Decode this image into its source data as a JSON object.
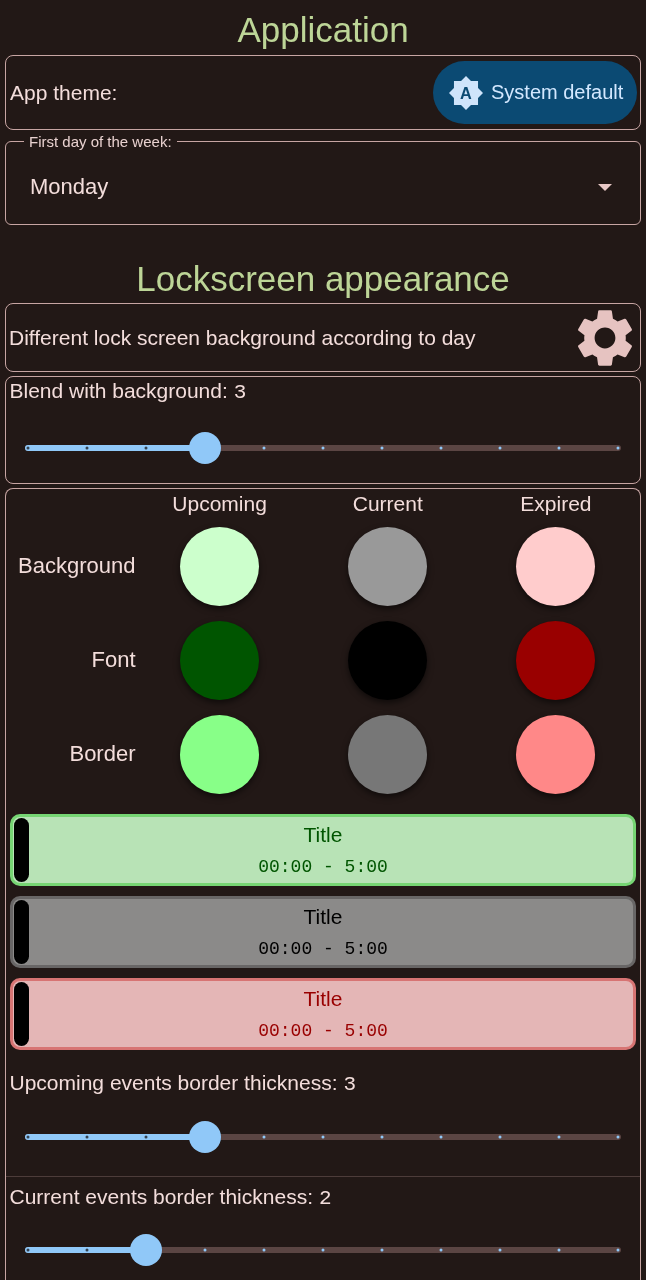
{
  "application": {
    "heading": "Application",
    "app_theme": {
      "label": "App theme:",
      "button": {
        "icon_letter": "A",
        "label": "System default"
      }
    },
    "first_day": {
      "label": "First day of the week:",
      "value": "Monday"
    }
  },
  "lockscreen": {
    "heading": "Lockscreen appearance",
    "day_background": {
      "label": "Different lock screen background according to day"
    },
    "blend": {
      "label": "Blend with background:",
      "value": "3",
      "level": 0.3
    },
    "colors": {
      "columns": [
        "Upcoming",
        "Current",
        "Expired"
      ],
      "rows": [
        {
          "label": "Background",
          "swatches": [
            {
              "color": "#ccffcc"
            },
            {
              "color": "#999999"
            },
            {
              "color": "#ffcccc"
            }
          ]
        },
        {
          "label": "Font",
          "swatches": [
            {
              "color": "#005500"
            },
            {
              "color": "#000000"
            },
            {
              "color": "#990000"
            }
          ]
        },
        {
          "label": "Border",
          "swatches": [
            {
              "color": "#88ff88"
            },
            {
              "color": "#777777"
            },
            {
              "color": "#ff8888"
            }
          ]
        }
      ]
    },
    "previews": [
      {
        "title": "Title",
        "time": "00:00 - 5:00"
      },
      {
        "title": "Title",
        "time": "00:00 - 5:00"
      },
      {
        "title": "Title",
        "time": "00:00 - 5:00"
      }
    ],
    "border_thickness": [
      {
        "label": "Upcoming events border thickness:",
        "value": "3",
        "level": 0.3
      },
      {
        "label": "Current events border thickness:",
        "value": "2",
        "level": 0.2
      }
    ]
  }
}
